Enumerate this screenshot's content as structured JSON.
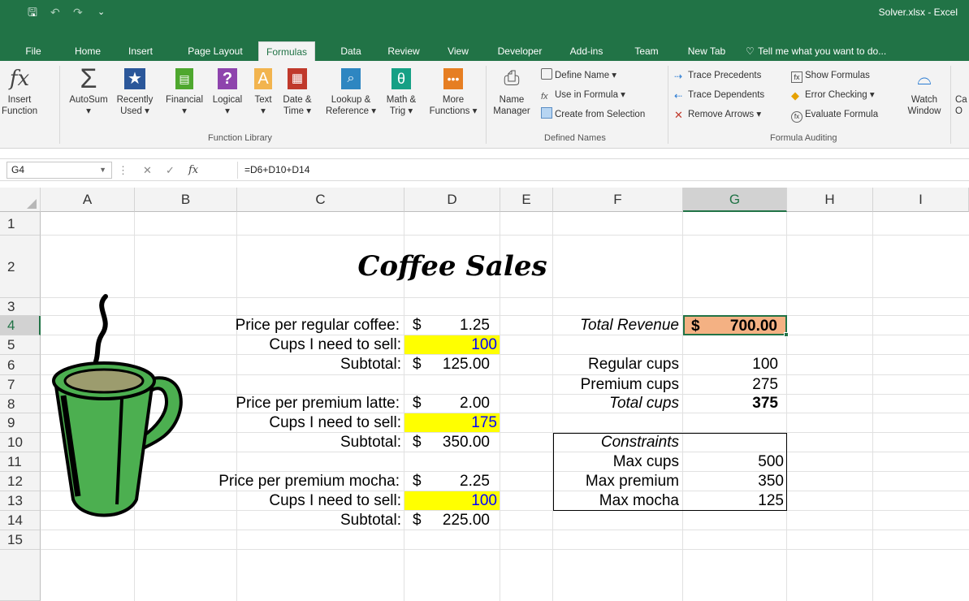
{
  "window": {
    "title": "Solver.xlsx - Excel",
    "quick_access": {
      "save": "🖫",
      "undo": "↶",
      "redo": "↷",
      "customize": "⌄"
    }
  },
  "tabs": [
    {
      "label": "File"
    },
    {
      "label": "Home"
    },
    {
      "label": "Insert"
    },
    {
      "label": "Page Layout"
    },
    {
      "label": "Formulas",
      "active": true
    },
    {
      "label": "Data"
    },
    {
      "label": "Review"
    },
    {
      "label": "View"
    },
    {
      "label": "Developer"
    },
    {
      "label": "Add-ins"
    },
    {
      "label": "Team"
    },
    {
      "label": "New Tab"
    }
  ],
  "tell_me": "Tell me what you want to do...",
  "ribbon": {
    "insert_function": {
      "line1": "Insert",
      "line2": "Function"
    },
    "autosum": {
      "line1": "AutoSum",
      "line2": "▾"
    },
    "recently_used": {
      "line1": "Recently",
      "line2": "Used ▾"
    },
    "financial": {
      "line1": "Financial",
      "line2": "▾"
    },
    "logical": {
      "line1": "Logical",
      "line2": "▾"
    },
    "text": {
      "line1": "Text",
      "line2": "▾"
    },
    "date_time": {
      "line1": "Date &",
      "line2": "Time ▾"
    },
    "lookup": {
      "line1": "Lookup &",
      "line2": "Reference ▾"
    },
    "math_trig": {
      "line1": "Math &",
      "line2": "Trig ▾"
    },
    "more_functions": {
      "line1": "More",
      "line2": "Functions ▾"
    },
    "function_library_label": "Function Library",
    "name_manager": {
      "line1": "Name",
      "line2": "Manager"
    },
    "define_name": "Define Name ▾",
    "use_in_formula": "Use in Formula ▾",
    "create_from_selection": "Create from Selection",
    "defined_names_label": "Defined Names",
    "trace_precedents": "Trace Precedents",
    "trace_dependents": "Trace Dependents",
    "remove_arrows": "Remove Arrows ▾",
    "show_formulas": "Show Formulas",
    "error_checking": "Error Checking ▾",
    "evaluate_formula": "Evaluate Formula",
    "formula_auditing_label": "Formula Auditing",
    "watch_window": {
      "line1": "Watch",
      "line2": "Window"
    },
    "calc_partial": {
      "line1": "Ca",
      "line2": "O"
    }
  },
  "formula_bar": {
    "name_box": "G4",
    "fx": "fx",
    "formula": "=D6+D10+D14"
  },
  "columns": [
    "A",
    "B",
    "C",
    "D",
    "E",
    "F",
    "G",
    "H",
    "I"
  ],
  "rows": [
    "1",
    "2",
    "3",
    "4",
    "5",
    "6",
    "7",
    "8",
    "9",
    "10",
    "11",
    "12",
    "13",
    "14",
    "15"
  ],
  "sheet": {
    "title": "Coffee Sales",
    "c4": "Price per regular coffee:",
    "d4_symbol": "$",
    "d4_value": "1.25",
    "c5": "Cups I need to sell:",
    "d5": "100",
    "c6": "Subtotal:",
    "d6_symbol": "$",
    "d6_value": "125.00",
    "c8": "Price per premium latte:",
    "d8_symbol": "$",
    "d8_value": "2.00",
    "c9": "Cups I need to sell:",
    "d9": "175",
    "c10": "Subtotal:",
    "d10_symbol": "$",
    "d10_value": "350.00",
    "c12": "Price per premium mocha:",
    "d12_symbol": "$",
    "d12_value": "2.25",
    "c13": "Cups I need to sell:",
    "d13": "100",
    "c14": "Subtotal:",
    "d14_symbol": "$",
    "d14_value": "225.00",
    "f4": "Total Revenue",
    "g4_symbol": "$",
    "g4_value": "700.00",
    "f6": "Regular cups",
    "g6": "100",
    "f7": "Premium cups",
    "g7": "275",
    "f8": "Total cups",
    "g8": "375",
    "f10": "Constraints",
    "f11": "Max cups",
    "g11": "500",
    "f12": "Max premium",
    "g12": "350",
    "f13": "Max mocha",
    "g13": "125"
  },
  "colors": {
    "excel_green": "#217346",
    "input_yellow": "#ffff00",
    "input_blue": "#0000ff",
    "revenue_orange": "#f4b183",
    "mug_green": "#4caf50"
  }
}
